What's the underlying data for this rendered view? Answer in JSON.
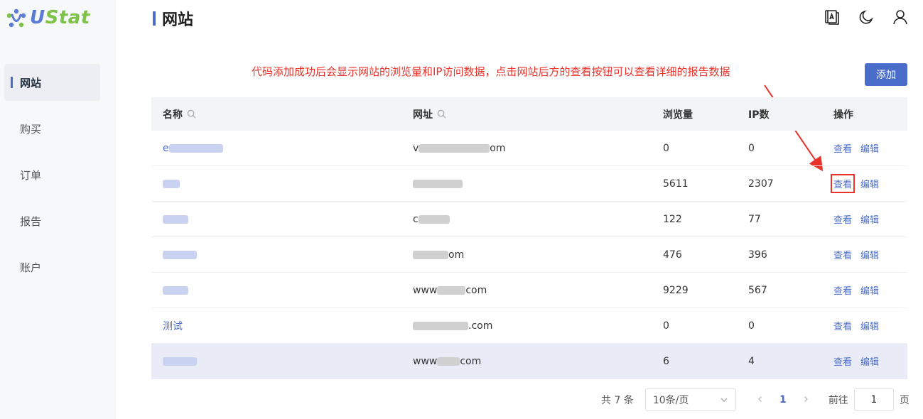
{
  "app": {
    "logo_u": "U",
    "logo_stat": "Stat"
  },
  "sidebar": {
    "items": [
      {
        "label": "网站",
        "active": true
      },
      {
        "label": "购买"
      },
      {
        "label": "订单"
      },
      {
        "label": "报告"
      },
      {
        "label": "账户"
      }
    ]
  },
  "header": {
    "title": "网站",
    "icons": [
      "translate-icon",
      "moon-icon",
      "user-icon"
    ]
  },
  "annotation": "代码添加成功后会显示网站的浏览量和IP访问数据，点击网站后方的查看按钮可以查看详细的报告数据",
  "toolbar": {
    "add_label": "添加"
  },
  "table": {
    "columns": {
      "name": "名称",
      "url": "网址",
      "views": "浏览量",
      "ip": "IP数",
      "actions": "操作"
    },
    "rows": [
      {
        "name": "e",
        "url_prefix": "v",
        "url_suffix": "om",
        "views": "0",
        "ip": "0",
        "view": "查看",
        "edit": "编辑"
      },
      {
        "name": "",
        "url_prefix": "",
        "url_suffix": "",
        "views": "5611",
        "ip": "2307",
        "view": "查看",
        "edit": "编辑"
      },
      {
        "name": "",
        "url_prefix": "c",
        "url_suffix": "",
        "views": "122",
        "ip": "77",
        "view": "查看",
        "edit": "编辑"
      },
      {
        "name": "",
        "url_prefix": "",
        "url_suffix": "om",
        "views": "476",
        "ip": "396",
        "view": "查看",
        "edit": "编辑"
      },
      {
        "name": "",
        "url_prefix": "www",
        "url_suffix": "com",
        "views": "9229",
        "ip": "567",
        "view": "查看",
        "edit": "编辑"
      },
      {
        "name": "测试",
        "url_prefix": "",
        "url_suffix": ".com",
        "views": "0",
        "ip": "0",
        "view": "查看",
        "edit": "编辑"
      },
      {
        "name": "",
        "url_prefix": "www",
        "url_suffix": "com",
        "views": "6",
        "ip": "4",
        "view": "查看",
        "edit": "编辑"
      }
    ]
  },
  "pagination": {
    "total": "共 7 条",
    "page_size": "10条/页",
    "current_page": "1",
    "goto_label": "前往",
    "goto_value": "1",
    "page_unit": "页"
  },
  "colors": {
    "accent": "#4a6dc9",
    "annotation": "#e8322a",
    "logo_green": "#7fc24a"
  }
}
